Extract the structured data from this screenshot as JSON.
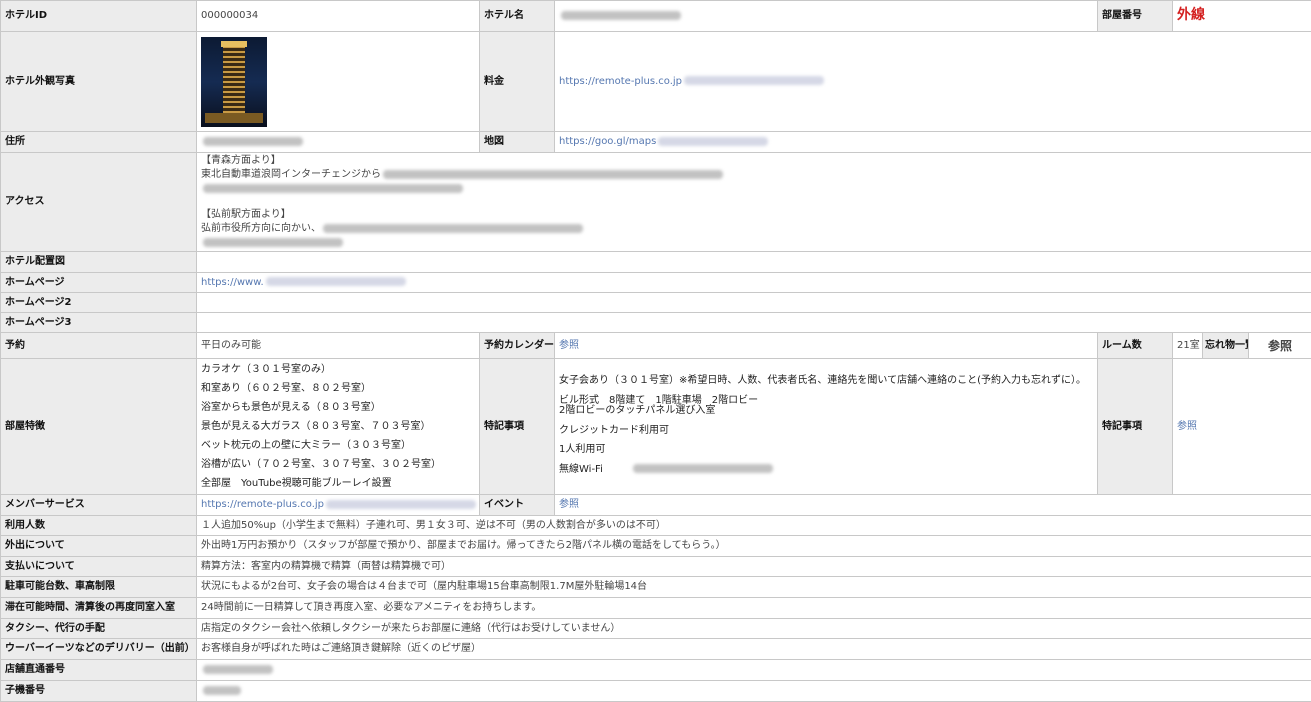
{
  "hotel_id": {
    "label": "ホテルID",
    "value": "000000034"
  },
  "hotel_name": {
    "label": "ホテル名"
  },
  "room_number": {
    "label": "部屋番号",
    "value": "外線"
  },
  "exterior_photo": {
    "label": "ホテル外観写真"
  },
  "price": {
    "label": "料金",
    "url_prefix": "https://remote-plus.co.jp"
  },
  "address": {
    "label": "住所"
  },
  "map": {
    "label": "地図",
    "url_prefix": "https://goo.gl/maps"
  },
  "access": {
    "label": "アクセス",
    "lines": [
      "【青森方面より】",
      "東北自動車道浪岡インターチェンジから",
      "",
      "【弘前駅方面より】",
      "弘前市役所方向に向かい、"
    ]
  },
  "layout_map": {
    "label": "ホテル配置図"
  },
  "homepage": {
    "label": "ホームページ",
    "url_prefix": "https://www."
  },
  "homepage2": {
    "label": "ホームページ2"
  },
  "homepage3": {
    "label": "ホームページ3"
  },
  "reservation": {
    "label": "予約",
    "value": "平日のみ可能",
    "calendar_label": "予約カレンダー",
    "calendar_link": "参照",
    "rooms_label": "ルーム数",
    "rooms_value": "21室",
    "lost_label": "忘れ物一覧",
    "lost_link": "参照"
  },
  "room_features": {
    "label": "部屋特徴",
    "items": [
      "カラオケ（３０１号室のみ）",
      "和室あり（６０２号室、８０２号室）",
      "浴室からも景色が見える（８０３号室）",
      "景色が見える大ガラス（８０３号室、７０３号室）",
      "ベット枕元の上の壁に大ミラー（３０３号室）",
      "浴槽が広い（７０２号室、３０７号室、３０２号室）",
      "全部屋　YouTube視聴可能ブルーレイ設置"
    ]
  },
  "special_notes": {
    "label": "特記事項",
    "items": [
      "女子会あり（３０１号室）※希望日時、人数、代表者氏名、連絡先を聞いて店舗へ連絡のこと(予約入力も忘れずに）。",
      "ビル形式　8階建て　1階駐車場　2階ロビー",
      "2階ロビーのタッチパネル選び入室",
      "クレジットカード利用可",
      "1人利用可",
      "無線Wi-Fi"
    ],
    "label2": "特記事項",
    "link2": "参照"
  },
  "member_service": {
    "label": "メンバーサービス",
    "url_prefix": "https://remote-plus.co.jp"
  },
  "event": {
    "label": "イベント",
    "link": "参照"
  },
  "usage_count": {
    "label": "利用人数",
    "value": "１人追加50%up（小学生まで無料）子連れ可、男１女３可、逆は不可（男の人数割合が多いのは不可）"
  },
  "going_out": {
    "label": "外出について",
    "value": "外出時1万円お預かり（スタッフが部屋で預かり、部屋までお届け。帰ってきたら2階パネル横の電話をしてもらう。）"
  },
  "payment": {
    "label": "支払いについて",
    "value": "精算方法：客室内の精算機で精算（両替は精算機で可）"
  },
  "parking": {
    "label": "駐車可能台数、車高制限",
    "value": "状況にもよるが2台可、女子会の場合は４台まで可（屋内駐車場15台車高制限1.7M屋外駐輪場14台"
  },
  "stay": {
    "label": "滞在可能時間、清算後の再度同室入室",
    "value": "24時間前に一日精算して頂き再度入室、必要なアメニティをお持ちします。"
  },
  "taxi": {
    "label": "タクシー、代行の手配",
    "value": "店指定のタクシー会社へ依頼しタクシーが来たらお部屋に連絡（代行はお受けしていません）"
  },
  "delivery": {
    "label": "ウーバーイーツなどのデリバリー（出前）",
    "value": "お客様自身が呼ばれた時はご連絡頂き鍵解除（近くのピザ屋）"
  },
  "store_direct": {
    "label": "店舗直通番号"
  },
  "handset": {
    "label": "子機番号"
  }
}
